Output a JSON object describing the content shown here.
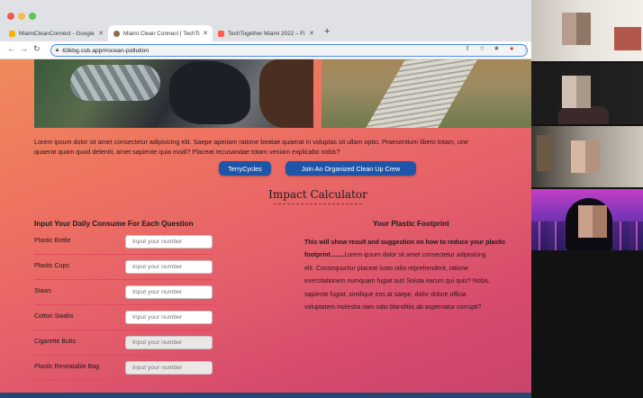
{
  "browser": {
    "tabs": [
      {
        "title": "MiamiCleanConnect - Google",
        "favicon_color": "#f4b400"
      },
      {
        "title": "Miami Clean Connect | TechTo",
        "favicon_color": "#8a6d4b"
      },
      {
        "title": "TechTogether Miami 2022 – Fi",
        "favicon_color": "#ff5c4d"
      }
    ],
    "url": "63kbg.csb.app/#ocean-pollution"
  },
  "page": {
    "intro_text": "Lorem ipsum dolor sit amet consectetur adipisicing elit. Saepe aperiam ratione beatae quaerat in voluptas sit ullam optio. Praesentium libero totam, une quaerat quam quod deleniti, amet sapiente quia modi? Placeat recusandae totam veniam explicabo nobis?",
    "intro_line1": "Lorem ipsum dolor sit amet consectetur adipisicing elit. Saepe aperiam ratione beatae quaerat in voluptas sit ullam optio. Praesentium libero totam, une",
    "intro_line2": "quaerat quam quod deleniti, amet sapiente quia modi? Placeat recusandae totam veniam explicabo nobis?",
    "buttons": {
      "terry": "TerryCycles",
      "crew": "Join An Organized Clean Up Crew"
    },
    "calculator_title": "Impact Calculator",
    "input_heading": "Input Your Daily Consume For Each Question",
    "footprint_heading": "Your Plastic Footprint",
    "items": [
      {
        "label": "Plastic Bottle",
        "placeholder": "Input your number"
      },
      {
        "label": "Plastic Cups",
        "placeholder": "Input your number"
      },
      {
        "label": "Staws",
        "placeholder": "Input your number"
      },
      {
        "label": "Cotton Swabs",
        "placeholder": "Input your number"
      },
      {
        "label": "Cigarette Butts",
        "placeholder": "Input your number"
      },
      {
        "label": "Plastic Resealable Bag",
        "placeholder": "Input your number"
      }
    ],
    "result_bold_1": "This will show result and suggestion on how to reduce your plastic",
    "result_bold_2": "footprint........",
    "result_rest_1": "Lorem ipsum dolor sit amet consectetur adipisicing",
    "result_lines": [
      "elit. Consequuntur placeat iusto odio reprehenderit, ratione",
      "exercitationem numquam fugiat aut! Soluta earum qui quis? Nobis,",
      "sapiente fugiat, similique eos at saepe, dolor dolore officia",
      "voluptatem molestia nam odio blanditiis ab aspernatur corrupti?"
    ]
  },
  "colors": {
    "accent_button": "#1f55a8",
    "page_gradient_start": "#f08a5a",
    "page_gradient_end": "#c9446c"
  }
}
